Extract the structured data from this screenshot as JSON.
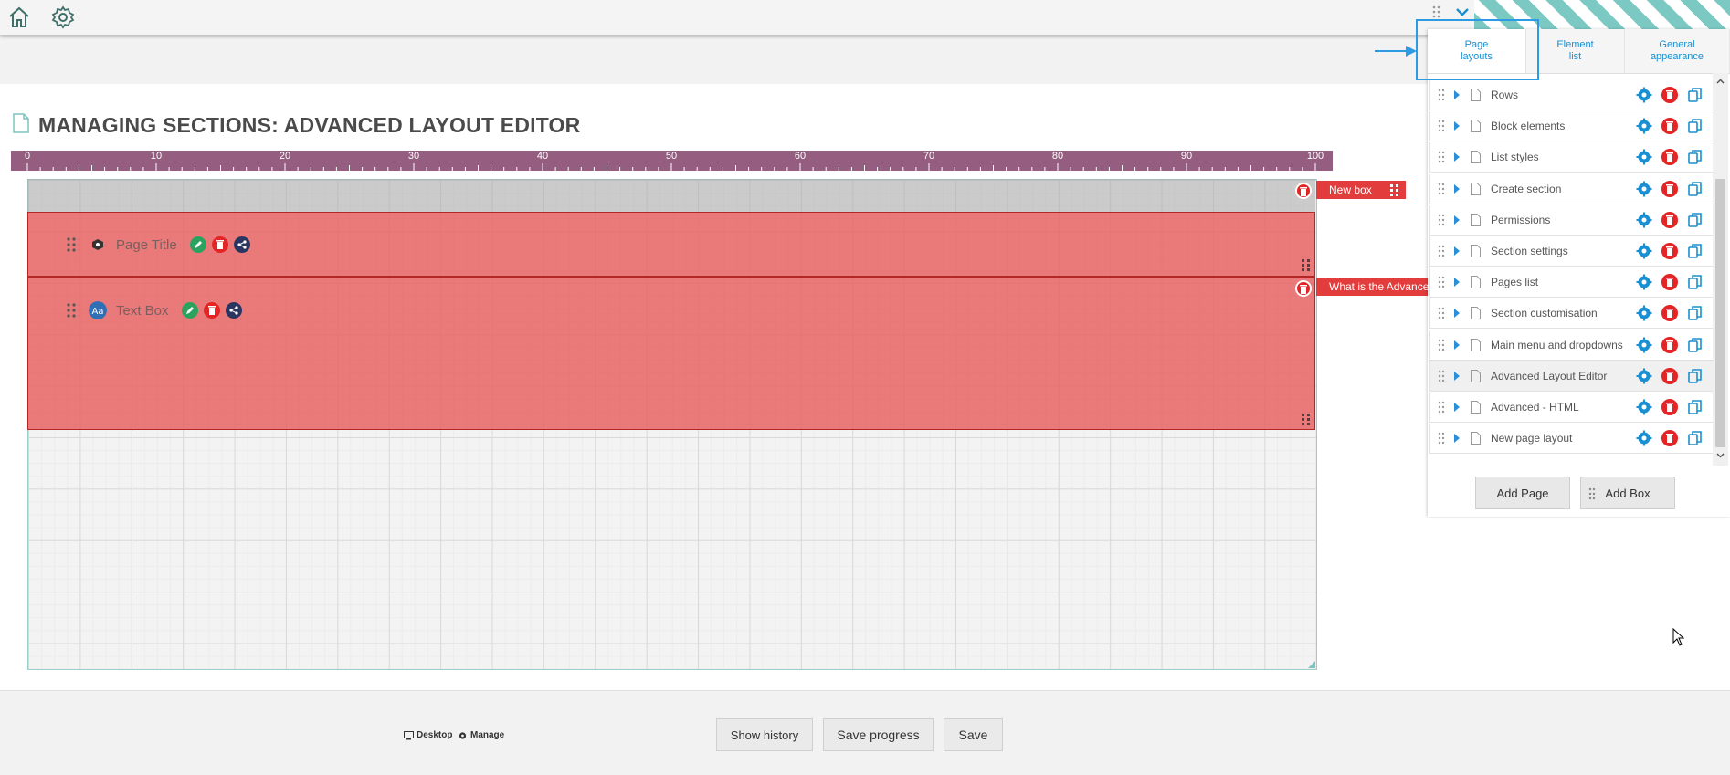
{
  "header": {
    "home_icon": "home-icon",
    "settings_icon": "gear-icon"
  },
  "page": {
    "title": "MANAGING SECTIONS: ADVANCED LAYOUT EDITOR"
  },
  "ruler": {
    "ticks": [
      "0",
      "10",
      "20",
      "30",
      "40",
      "50",
      "60",
      "70",
      "80",
      "90",
      "100"
    ]
  },
  "canvas": {
    "boxes": [
      {
        "tag": "New box"
      },
      {
        "tag": "What is the Advanced Layout Editor?"
      }
    ],
    "elements": [
      {
        "label": "Page Title"
      },
      {
        "label": "Text Box"
      }
    ]
  },
  "panel": {
    "tabs": [
      {
        "label_line1": "Page",
        "label_line2": "layouts"
      },
      {
        "label_line1": "Element",
        "label_line2": "list"
      },
      {
        "label_line1": "General",
        "label_line2": "appearance"
      }
    ],
    "items": [
      {
        "label": "Rows"
      },
      {
        "label": "Block elements"
      },
      {
        "label": "List styles"
      },
      {
        "label": "Create section"
      },
      {
        "label": "Permissions"
      },
      {
        "label": "Section settings"
      },
      {
        "label": "Pages list"
      },
      {
        "label": "Section customisation"
      },
      {
        "label": "Main menu and dropdowns"
      },
      {
        "label": "Advanced Layout Editor"
      },
      {
        "label": "Advanced - HTML"
      },
      {
        "label": "New page layout"
      }
    ],
    "add_page": "Add Page",
    "add_box": "Add Box"
  },
  "footer": {
    "desktop": "Desktop",
    "manage": "Manage",
    "show_history": "Show history",
    "save_progress": "Save progress",
    "save": "Save"
  },
  "colors": {
    "accent": "#2c9be3",
    "danger": "#e42525",
    "ruler": "#955d7f",
    "box": "#e86464"
  }
}
